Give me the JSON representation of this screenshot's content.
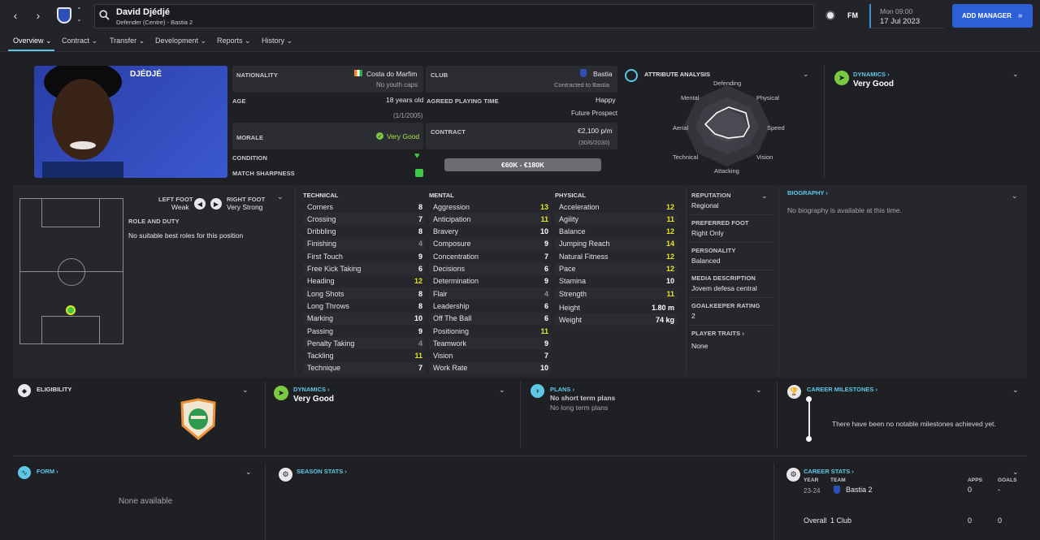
{
  "header": {
    "player_name": "David Djédjé",
    "player_sub": "Defender (Centre) - Bastia 2",
    "fm_label": "FM",
    "date_day": "Mon 09:00",
    "date": "17 Jul 2023",
    "add_manager": "ADD MANAGER"
  },
  "nav": [
    "Overview",
    "Contract",
    "Transfer",
    "Development",
    "Reports",
    "History"
  ],
  "profile": {
    "surname": "DJÉDJÉ",
    "nationality_label": "NATIONALITY",
    "nationality": "Costa do Marfim",
    "caps": "No youth caps",
    "club_label": "CLUB",
    "club": "Bastia",
    "club_status": "Contracted to Bastia",
    "age_label": "AGE",
    "age": "18 years old",
    "dob": "(1/1/2005)",
    "apt_label": "AGREED PLAYING TIME",
    "apt_status": "Happy",
    "apt": "Future Prospect",
    "morale_label": "MORALE",
    "morale": "Very Good",
    "contract_label": "CONTRACT",
    "wage": "€2,100 p/m",
    "contract_end": "(30/6/2030)",
    "condition_label": "CONDITION",
    "sharpness_label": "MATCH SHARPNESS",
    "value_range": "€60K - €180K"
  },
  "attr_analysis": {
    "title": "ATTRIBUTE ANALYSIS",
    "labels": [
      "Defending",
      "Physical",
      "Speed",
      "Vision",
      "Attacking",
      "Technical",
      "Aerial",
      "Mental"
    ]
  },
  "dynamics_top": {
    "title": "DYNAMICS",
    "value": "Very Good"
  },
  "feet": {
    "left_label": "LEFT FOOT",
    "left": "Weak",
    "right_label": "RIGHT FOOT",
    "right": "Very Strong"
  },
  "role": {
    "title": "ROLE AND DUTY",
    "text": "No suitable best roles for this position"
  },
  "technical": {
    "title": "TECHNICAL",
    "items": [
      {
        "name": "Corners",
        "value": "8"
      },
      {
        "name": "Crossing",
        "value": "7"
      },
      {
        "name": "Dribbling",
        "value": "8"
      },
      {
        "name": "Finishing",
        "value": "4"
      },
      {
        "name": "First Touch",
        "value": "9"
      },
      {
        "name": "Free Kick Taking",
        "value": "6"
      },
      {
        "name": "Heading",
        "value": "12"
      },
      {
        "name": "Long Shots",
        "value": "8"
      },
      {
        "name": "Long Throws",
        "value": "8"
      },
      {
        "name": "Marking",
        "value": "10"
      },
      {
        "name": "Passing",
        "value": "9"
      },
      {
        "name": "Penalty Taking",
        "value": "4"
      },
      {
        "name": "Tackling",
        "value": "11"
      },
      {
        "name": "Technique",
        "value": "7"
      }
    ]
  },
  "mental": {
    "title": "MENTAL",
    "items": [
      {
        "name": "Aggression",
        "value": "13"
      },
      {
        "name": "Anticipation",
        "value": "11"
      },
      {
        "name": "Bravery",
        "value": "10"
      },
      {
        "name": "Composure",
        "value": "9"
      },
      {
        "name": "Concentration",
        "value": "7"
      },
      {
        "name": "Decisions",
        "value": "6"
      },
      {
        "name": "Determination",
        "value": "9"
      },
      {
        "name": "Flair",
        "value": "4"
      },
      {
        "name": "Leadership",
        "value": "6"
      },
      {
        "name": "Off The Ball",
        "value": "6"
      },
      {
        "name": "Positioning",
        "value": "11"
      },
      {
        "name": "Teamwork",
        "value": "9"
      },
      {
        "name": "Vision",
        "value": "7"
      },
      {
        "name": "Work Rate",
        "value": "10"
      }
    ]
  },
  "physical": {
    "title": "PHYSICAL",
    "items": [
      {
        "name": "Acceleration",
        "value": "12"
      },
      {
        "name": "Agility",
        "value": "11"
      },
      {
        "name": "Balance",
        "value": "12"
      },
      {
        "name": "Jumping Reach",
        "value": "14"
      },
      {
        "name": "Natural Fitness",
        "value": "12"
      },
      {
        "name": "Pace",
        "value": "12"
      },
      {
        "name": "Stamina",
        "value": "10"
      },
      {
        "name": "Strength",
        "value": "11"
      }
    ],
    "height_label": "Height",
    "height": "1.80 m",
    "weight_label": "Weight",
    "weight": "74 kg"
  },
  "info": {
    "reputation_label": "REPUTATION",
    "reputation": "Regional",
    "foot_label": "PREFERRED FOOT",
    "foot": "Right Only",
    "personality_label": "PERSONALITY",
    "personality": "Balanced",
    "media_label": "MEDIA DESCRIPTION",
    "media": "Jovem defesa central",
    "gk_label": "GOALKEEPER RATING",
    "gk": "2",
    "traits_label": "PLAYER TRAITS",
    "traits": "None"
  },
  "biography": {
    "title": "BIOGRAPHY",
    "text": "No biography is available at this time."
  },
  "eligibility": {
    "title": "ELIGIBILITY"
  },
  "dynamics_bottom": {
    "title": "DYNAMICS",
    "value": "Very Good"
  },
  "plans": {
    "title": "PLANS",
    "short": "No short term plans",
    "long": "No long term plans"
  },
  "milestones": {
    "title": "CAREER MILESTONES",
    "text": "There have been no notable milestones achieved yet."
  },
  "form": {
    "title": "FORM",
    "text": "None available"
  },
  "season_stats": {
    "title": "SEASON STATS"
  },
  "career_stats": {
    "title": "CAREER STATS",
    "col_year": "YEAR",
    "col_team": "TEAM",
    "col_apps": "APPS",
    "col_goals": "GOALS",
    "row_year": "23-24",
    "row_team": "Bastia 2",
    "row_apps": "0",
    "row_goals": "-",
    "overall": "Overall",
    "overall_clubs": "1 Club",
    "overall_apps": "0",
    "overall_goals": "0"
  },
  "colors": {
    "accent": "#2d5fd6",
    "highlight": "#e6e61e",
    "link": "#5cc8e6",
    "good": "#3ec94a"
  }
}
